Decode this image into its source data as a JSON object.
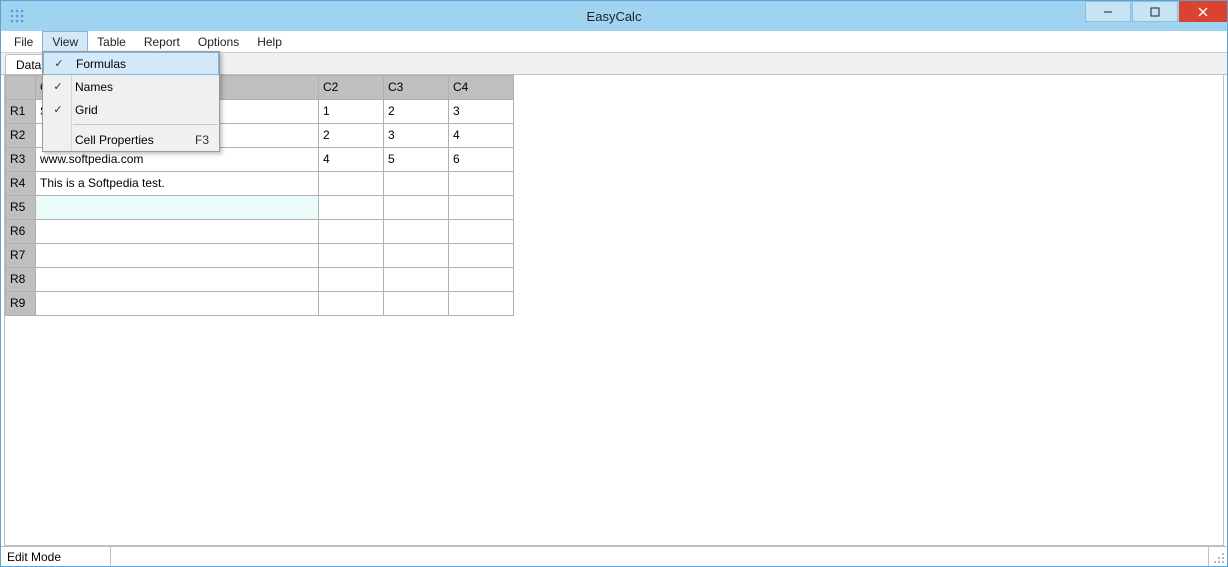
{
  "window": {
    "title": "EasyCalc"
  },
  "menubar": {
    "items": [
      "File",
      "View",
      "Table",
      "Report",
      "Options",
      "Help"
    ],
    "active_index": 1
  },
  "tabs": {
    "items": [
      "Data"
    ]
  },
  "dropdown": {
    "items": [
      {
        "label": "Formulas",
        "checked": true,
        "highlighted": true,
        "shortcut": ""
      },
      {
        "label": "Names",
        "checked": true,
        "highlighted": false,
        "shortcut": ""
      },
      {
        "label": "Grid",
        "checked": true,
        "highlighted": false,
        "shortcut": ""
      },
      {
        "separator": true
      },
      {
        "label": "Cell Properties",
        "checked": false,
        "highlighted": false,
        "shortcut": "F3"
      }
    ]
  },
  "spreadsheet": {
    "columns": [
      "C1",
      "C2",
      "C3",
      "C4"
    ],
    "rows": [
      "R1",
      "R2",
      "R3",
      "R4",
      "R5",
      "R6",
      "R7",
      "R8",
      "R9"
    ],
    "cells": {
      "R1": {
        "C1": "Softpedia test",
        "C2": "1",
        "C3": "2",
        "C4": "3"
      },
      "R2": {
        "C1": "",
        "C2": "2",
        "C3": "3",
        "C4": "4"
      },
      "R3": {
        "C1": "www.softpedia.com",
        "C2": "4",
        "C3": "5",
        "C4": "6"
      },
      "R4": {
        "C1": "This is a Softpedia test.",
        "C2": "",
        "C3": "",
        "C4": ""
      },
      "R5": {
        "C1": "",
        "C2": "",
        "C3": "",
        "C4": ""
      },
      "R6": {
        "C1": "",
        "C2": "",
        "C3": "",
        "C4": ""
      },
      "R7": {
        "C1": "",
        "C2": "",
        "C3": "",
        "C4": ""
      },
      "R8": {
        "C1": "",
        "C2": "",
        "C3": "",
        "C4": ""
      },
      "R9": {
        "C1": "",
        "C2": "",
        "C3": "",
        "C4": ""
      }
    },
    "selected": {
      "row": "R5",
      "col": "C1"
    }
  },
  "statusbar": {
    "mode": "Edit Mode"
  }
}
